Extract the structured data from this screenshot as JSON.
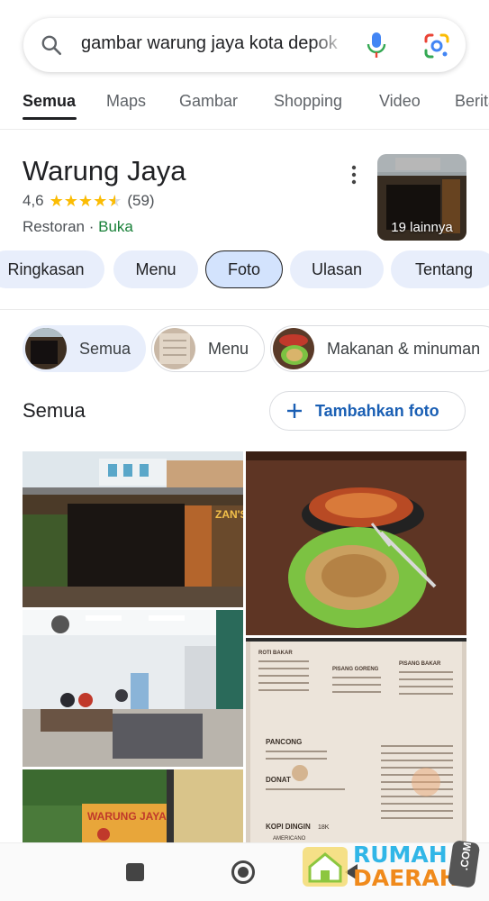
{
  "search": {
    "query": "gambar warung jaya kota depok",
    "icons": {
      "left": "search-icon",
      "voice": "mic-icon",
      "lens": "google-lens-icon"
    }
  },
  "tabs": [
    "Semua",
    "Maps",
    "Gambar",
    "Shopping",
    "Video",
    "Berita"
  ],
  "active_tab": "Semua",
  "business": {
    "name": "Warung Jaya",
    "rating": "4,6",
    "rating_value": 4.6,
    "review_count": "(59)",
    "category": "Restoran",
    "separator": "·",
    "status": "Buka",
    "more_photos": "19 lainnya"
  },
  "chips": [
    "Ringkasan",
    "Menu",
    "Foto",
    "Ulasan",
    "Tentang"
  ],
  "active_chip": "Foto",
  "photo_categories": [
    "Semua",
    "Menu",
    "Makanan & minuman"
  ],
  "section": {
    "title": "Semua",
    "add_photo_label": "Tambahkan foto"
  },
  "photos": [
    {
      "name": "storefront-photo",
      "banner": "ZAN'S"
    },
    {
      "name": "food-plates-photo"
    },
    {
      "name": "dining-room-photo"
    },
    {
      "name": "menu-board-photo",
      "headings": [
        "ROTI BAKAR",
        "PISANG GORENG",
        "PISANG BAKAR",
        "PANCONG",
        "DONAT",
        "KOPI DINGIN"
      ],
      "price": "18K",
      "note": "AMERICANO"
    },
    {
      "name": "shop-banner-photo",
      "banner": "WARUNG JAYA"
    }
  ],
  "watermark": {
    "line1": "RUMAH",
    "line2": "DAERAH",
    "suffix": ".COM"
  },
  "colors": {
    "open_green": "#188038",
    "star_yellow": "#fbbc04",
    "chip_bg": "#e8eefb",
    "link_blue": "#1a5fb4"
  }
}
